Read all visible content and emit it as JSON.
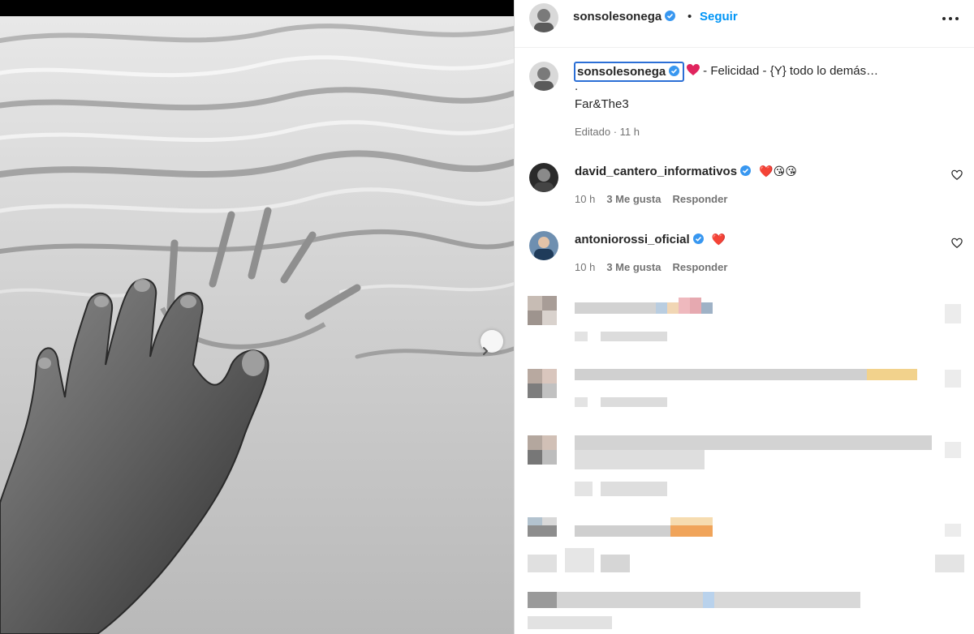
{
  "header": {
    "username": "sonsolesonega",
    "separator": "•",
    "follow_label": "Seguir"
  },
  "caption": {
    "username": "sonsolesonega",
    "text": " - Felicidad - {Y} todo lo demás…",
    "line2": ".",
    "line3": "Far&The3",
    "meta": "Editado · 11 h"
  },
  "comments": [
    {
      "username": "david_cantero_informativos",
      "emojis": "❤️😘😘",
      "time": "10 h",
      "likes": "3 Me gusta",
      "reply_label": "Responder"
    },
    {
      "username": "antoniorossi_oficial",
      "emojis": "❤️",
      "time": "10 h",
      "likes": "3 Me gusta",
      "reply_label": "Responder"
    }
  ],
  "colors": {
    "accent": "#0095f6",
    "verified": "#3897f0",
    "highlight_border": "#2b6fd6",
    "heart": "#e0245e"
  },
  "icons": [
    "verified-badge-icon",
    "more-options-icon",
    "heart-outline-icon",
    "chevron-right-icon"
  ]
}
